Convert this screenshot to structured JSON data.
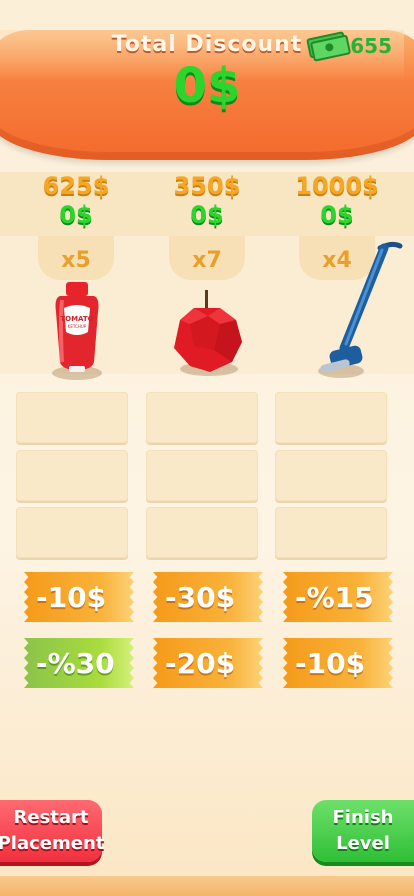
{
  "header": {
    "title": "Total Discount",
    "total_value": "0$",
    "money_count": "655",
    "money_icon": "cash-stack-icon"
  },
  "products": [
    {
      "name": "ketchup",
      "icon": "ketchup-bottle-icon",
      "price": "625$",
      "discount": "0$",
      "qty": "x5"
    },
    {
      "name": "apple",
      "icon": "apple-icon",
      "price": "350$",
      "discount": "0$",
      "qty": "x7"
    },
    {
      "name": "vacuum",
      "icon": "vacuum-cleaner-icon",
      "price": "1000$",
      "discount": "0$",
      "qty": "x4"
    }
  ],
  "coupons": [
    {
      "label": "-10$",
      "color": "orange"
    },
    {
      "label": "-30$",
      "color": "orange"
    },
    {
      "label": "-%15",
      "color": "orange"
    },
    {
      "label": "-%30",
      "color": "green"
    },
    {
      "label": "-20$",
      "color": "orange"
    },
    {
      "label": "-10$",
      "color": "orange"
    }
  ],
  "buttons": {
    "restart_line1": "Restart",
    "restart_line2": "Placement",
    "finish_line1": "Finish",
    "finish_line2": "Level"
  },
  "colors": {
    "accent_green": "#2bd52b",
    "price_orange": "#f5a623",
    "banner_orange": "#f7803f",
    "restart_red": "#f0303e",
    "finish_green": "#2fbf36"
  }
}
